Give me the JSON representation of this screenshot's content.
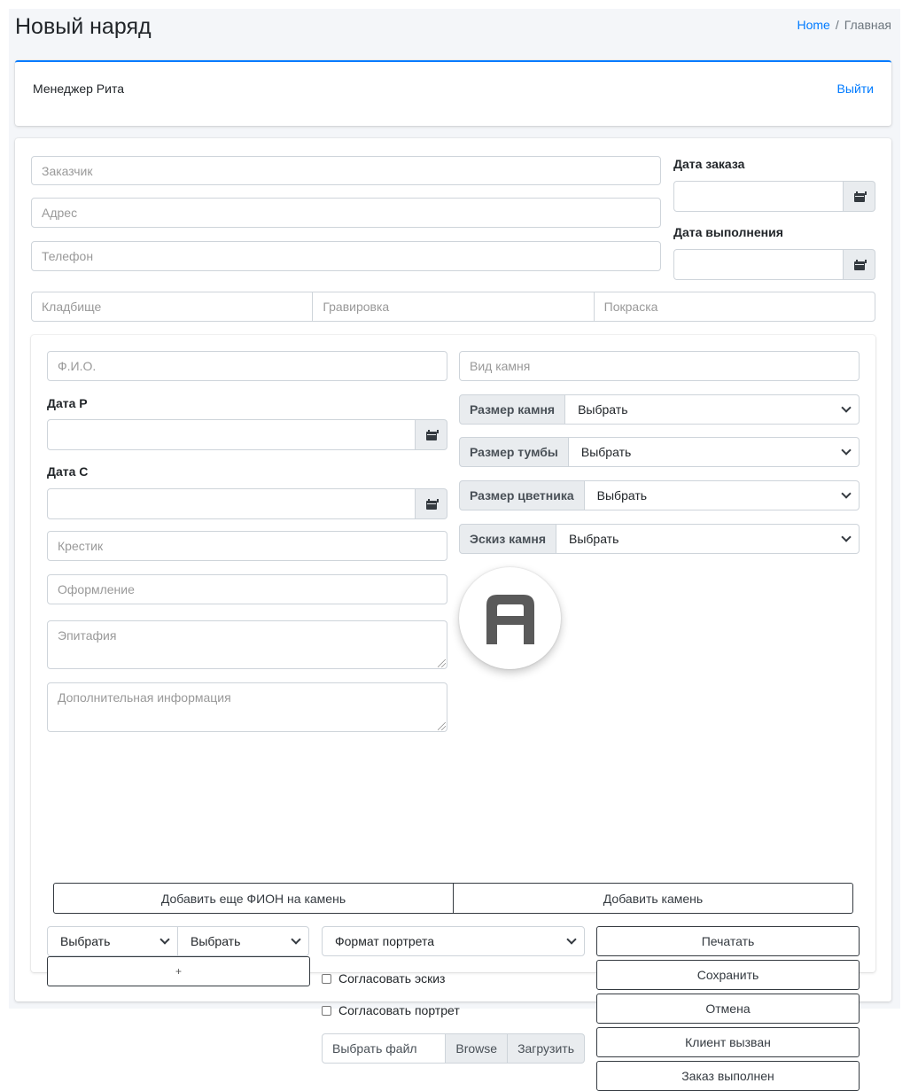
{
  "header": {
    "title": "Новый наряд",
    "breadcrumb": {
      "home": "Home",
      "separator": "/",
      "current": "Главная"
    }
  },
  "user": {
    "label": "Менеджер Рита",
    "logout": "Выйти"
  },
  "order": {
    "customer_placeholder": "Заказчик",
    "address_placeholder": "Адрес",
    "phone_placeholder": "Телефон",
    "order_date_label": "Дата заказа",
    "completion_date_label": "Дата выполнения",
    "cemetery_placeholder": "Кладбище",
    "engraving_placeholder": "Гравировка",
    "painting_placeholder": "Покраска"
  },
  "stone": {
    "fio_placeholder": "Ф.И.О.",
    "stone_type_placeholder": "Вид камня",
    "birth_date_label": "Дата Р",
    "death_date_label": "Дата С",
    "cross_placeholder": "Крестик",
    "design_placeholder": "Оформление",
    "epitaph_placeholder": "Эпитафия",
    "extra_info_placeholder": "Дополнительная информация",
    "selects": [
      {
        "label": "Размер камня",
        "value": "Выбрать"
      },
      {
        "label": "Размер тумбы",
        "value": "Выбрать"
      },
      {
        "label": "Размер цветника",
        "value": "Выбрать"
      },
      {
        "label": "Эскиз камня",
        "value": "Выбрать"
      }
    ],
    "logo_letter": "A"
  },
  "actions": {
    "add_fio": "Добавить еще ФИОН на камень",
    "add_stone": "Добавить камень",
    "select_a": "Выбрать",
    "select_b": "Выбрать",
    "plus": "+",
    "portrait_format": "Формат портрета",
    "approve_sketch": "Согласовать эскиз",
    "approve_portrait": "Согласовать портрет",
    "file_label": "Выбрать файл",
    "browse": "Browse",
    "upload": "Загрузить",
    "print": "Печатать",
    "save": "Сохранить",
    "cancel": "Отмена",
    "client_called": "Клиент вызван",
    "order_done": "Заказ выполнен"
  },
  "colors": {
    "accent": "#007bff",
    "background": "#f4f6f9",
    "logo": "#5a5a5a"
  }
}
